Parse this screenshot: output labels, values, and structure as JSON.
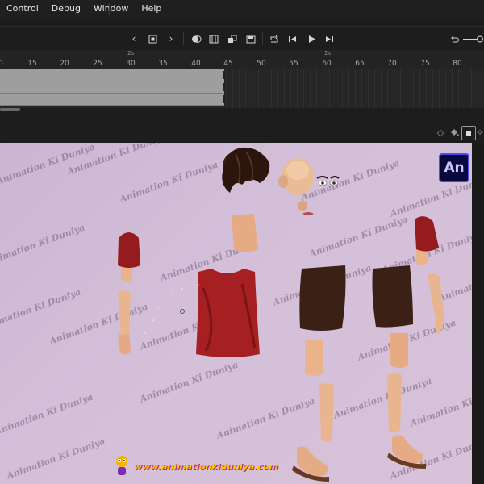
{
  "menu": {
    "items": [
      "Control",
      "Debug",
      "Window",
      "Help"
    ]
  },
  "ruler": {
    "fps_marks": [
      "2s",
      "2s"
    ],
    "frames": [
      "0",
      "15",
      "20",
      "25",
      "30",
      "35",
      "40",
      "45",
      "50",
      "55",
      "60",
      "65",
      "70",
      "75",
      "80"
    ]
  },
  "stage": {
    "watermark": "Animation Ki Duniya",
    "website": "www.animationkiduniya.com",
    "app_badge": "An"
  },
  "colors": {
    "stage_bg": "#d3bfd8",
    "shirt": "#a61f22",
    "shorts": "#3b2016",
    "skin": "#e8b48c",
    "badge_bg": "#09093b",
    "badge_border": "#4d4df0"
  }
}
